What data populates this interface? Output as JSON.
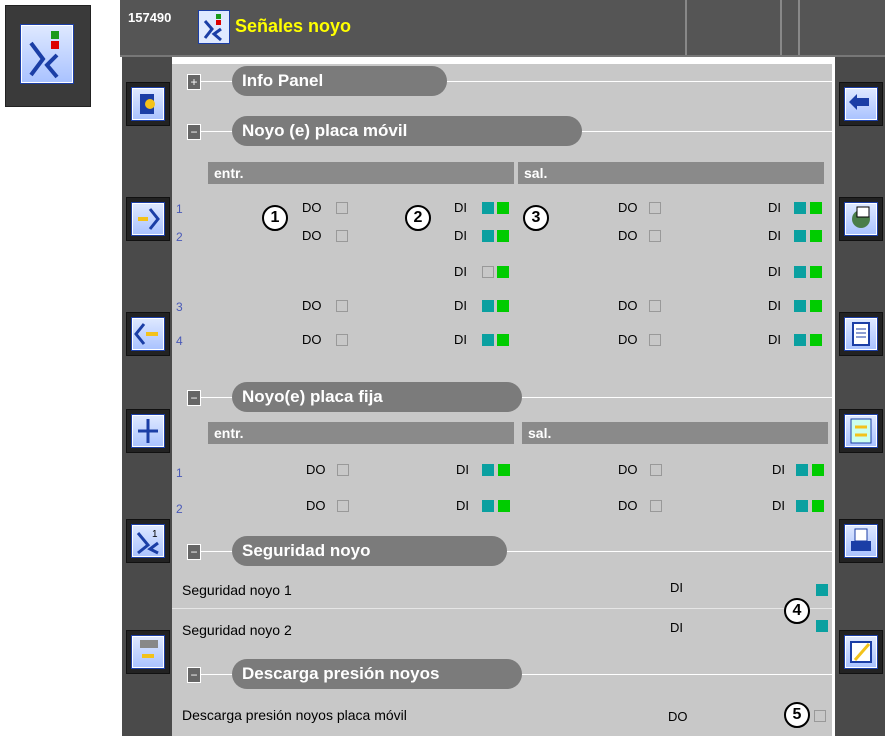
{
  "app": {
    "id": "157490",
    "title": "Señales noyo"
  },
  "sections": {
    "info": {
      "title": "Info Panel",
      "toggle": "+"
    },
    "movil": {
      "title": "Noyo (e) placa móvil",
      "toggle": "−",
      "entr_label": "entr.",
      "sal_label": "sal."
    },
    "fija": {
      "title": "Noyo(e) placa fija",
      "toggle": "−",
      "entr_label": "entr.",
      "sal_label": "sal."
    },
    "seguridad": {
      "title": "Seguridad noyo",
      "toggle": "−"
    },
    "descarga": {
      "title": "Descarga presión noyos",
      "toggle": "−"
    }
  },
  "movil_rows": [
    {
      "num": "1",
      "do1": "DO",
      "di1": "DI",
      "do2": "DO",
      "di2": "DI",
      "di1_state": [
        "teal",
        "green"
      ],
      "di2_state": [
        "teal",
        "green"
      ]
    },
    {
      "num": "2",
      "do1": "DO",
      "di1": "DI",
      "do2": "DO",
      "di2": "DI",
      "di1_state": [
        "teal",
        "green"
      ],
      "di2_state": [
        "teal",
        "green"
      ]
    },
    {
      "num": "",
      "do1": "",
      "di1": "DI",
      "do2": "",
      "di2": "DI",
      "di1_state": [
        "empty",
        "green"
      ],
      "di2_state": [
        "teal",
        "green"
      ]
    },
    {
      "num": "3",
      "do1": "DO",
      "di1": "DI",
      "do2": "DO",
      "di2": "DI",
      "di1_state": [
        "teal",
        "green"
      ],
      "di2_state": [
        "teal",
        "green"
      ]
    },
    {
      "num": "4",
      "do1": "DO",
      "di1": "DI",
      "do2": "DO",
      "di2": "DI",
      "di1_state": [
        "teal",
        "green"
      ],
      "di2_state": [
        "teal",
        "green"
      ]
    }
  ],
  "fija_rows": [
    {
      "num": "1",
      "do1": "DO",
      "di1": "DI",
      "do2": "DO",
      "di2": "DI"
    },
    {
      "num": "2",
      "do1": "DO",
      "di1": "DI",
      "do2": "DO",
      "di2": "DI"
    }
  ],
  "seguridad_rows": [
    {
      "label": "Seguridad noyo 1",
      "type": "DI"
    },
    {
      "label": "Seguridad noyo 2",
      "type": "DI"
    }
  ],
  "descarga_rows": [
    {
      "label": "Descarga presión noyos placa móvil",
      "type": "DO"
    }
  ],
  "callouts": [
    "1",
    "2",
    "3",
    "4",
    "5"
  ],
  "icons": {
    "main": "noyo-signals-icon",
    "left": [
      "mold-open-icon",
      "core-in-icon",
      "core-out-icon",
      "core-position-icon",
      "core-number-icon",
      "ejector-back-icon"
    ],
    "right": [
      "back-icon",
      "settings-icon",
      "document-icon",
      "transfer-icon",
      "print-icon",
      "edit-icon"
    ]
  },
  "colors": {
    "title": "#ffff00",
    "di_on_a": "#0aa0a0",
    "di_on_b": "#00cc00",
    "panel_bg": "#c8c8c8"
  }
}
